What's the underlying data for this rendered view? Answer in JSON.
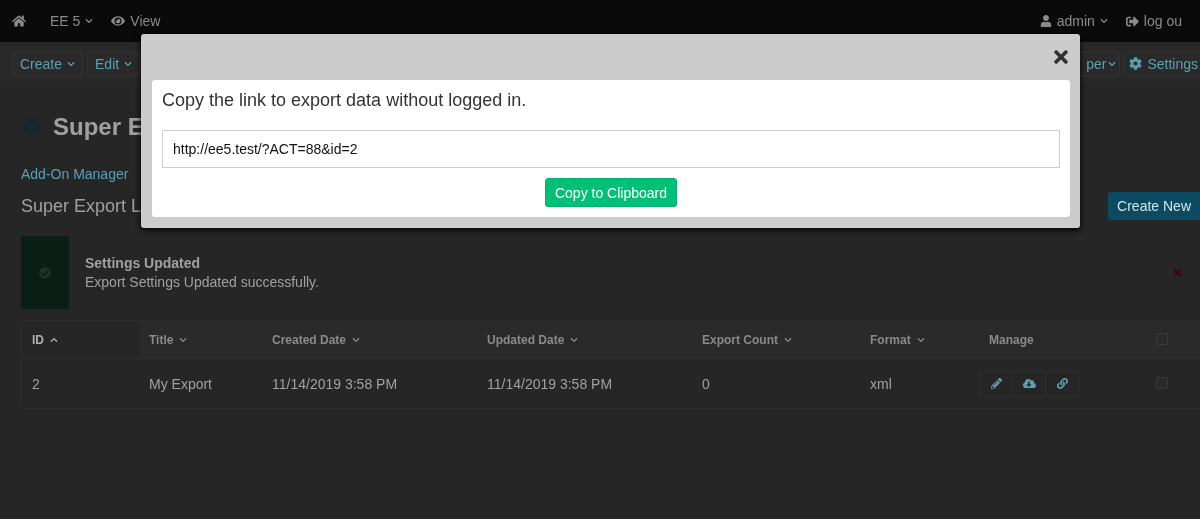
{
  "navbar": {
    "site": "EE 5",
    "view": "View",
    "user": "admin",
    "logout": "log ou"
  },
  "toolbar": {
    "left": [
      "Create",
      "Edit"
    ],
    "right": [
      {
        "label": "per",
        "kind": "menu"
      },
      {
        "label": "Settings",
        "kind": "settings"
      }
    ]
  },
  "page": {
    "title": "Super E",
    "breadcrumb": "Add-On Manager",
    "subtitle": "Super Export L",
    "create_button": "Create New"
  },
  "alert": {
    "title": "Settings Updated",
    "message": "Export Settings Updated successfully."
  },
  "table": {
    "columns": [
      {
        "label": "ID",
        "sortable": true,
        "selected": true
      },
      {
        "label": "Title",
        "sortable": true,
        "selected": false
      },
      {
        "label": "Created Date",
        "sortable": true,
        "selected": false
      },
      {
        "label": "Updated Date",
        "sortable": true,
        "selected": false
      },
      {
        "label": "Export Count",
        "sortable": true,
        "selected": false
      },
      {
        "label": "Format",
        "sortable": true,
        "selected": false
      },
      {
        "label": "Manage",
        "sortable": false,
        "selected": false
      }
    ],
    "select_all_checked": false,
    "rows": [
      {
        "cells": [
          "2",
          "My Export",
          "11/14/2019 3:58 PM",
          "11/14/2019 3:58 PM",
          "0",
          "xml"
        ],
        "checked": false
      }
    ]
  },
  "modal": {
    "message": "Copy the link to export data without logged in.",
    "link": "http://ee5.test/?ACT=88&id=2",
    "button": "Copy to Clipboard"
  }
}
